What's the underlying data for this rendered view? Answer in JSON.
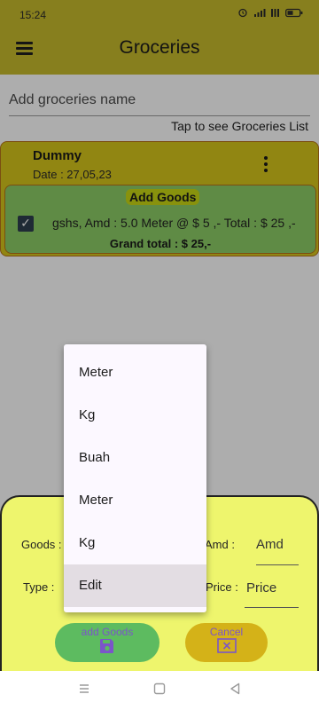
{
  "status_bar": {
    "time": "15:24"
  },
  "app_bar": {
    "title": "Groceries"
  },
  "main": {
    "name_placeholder": "Add groceries name",
    "see_list_link": "Tap to see Groceries List",
    "card": {
      "title": "Dummy",
      "date": "Date : 27,05,23",
      "add_goods_label": "Add Goods",
      "item_line": "gshs, Amd : 5.0 Meter @ $ 5 ,- Total : $ 25 ,-",
      "grand_total": "Grand total : $ 25,-"
    }
  },
  "sheet": {
    "goods_label": "Goods :",
    "amd_label": "Amd :",
    "amd_value": "Amd",
    "type_label": "Type :",
    "price_label": "Price :",
    "price_value": "Price",
    "add_button": "add Goods",
    "cancel_button": "Cancel"
  },
  "dropdown": {
    "items": [
      "Meter",
      "Kg",
      "Buah",
      "Meter",
      "Kg",
      "Edit"
    ],
    "highlighted": "Edit"
  },
  "colors": {
    "app_bar": "#c7bb2d",
    "card": "#d6c61b",
    "goods_box": "#8dcd66",
    "sheet": "#eef56d",
    "add_button": "#5dbb60",
    "cancel_button": "#d4b218"
  },
  "icons": {
    "menu": "hamburger-icon",
    "more": "more-vert-icon",
    "save": "save-icon",
    "cancel": "cancel-box-icon",
    "nav_recent": "recents-icon",
    "nav_home": "home-icon",
    "nav_back": "back-icon"
  }
}
